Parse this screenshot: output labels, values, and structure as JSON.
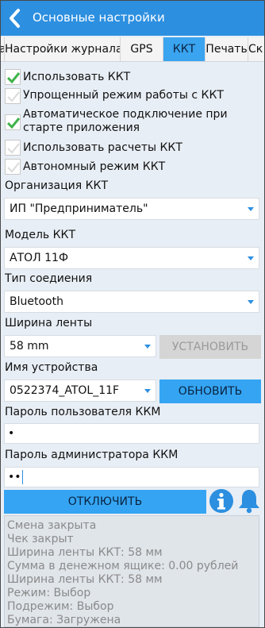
{
  "header": {
    "title": "Основные настройки"
  },
  "tabs": [
    {
      "label": "а"
    },
    {
      "label": "Настройки журнала"
    },
    {
      "label": "GPS"
    },
    {
      "label": "ККТ",
      "active": true
    },
    {
      "label": "Печать"
    },
    {
      "label": "Ск"
    }
  ],
  "checkboxes": [
    {
      "label": "Использовать ККТ",
      "checked": true
    },
    {
      "label": "Упрощенный режим работы с ККТ",
      "checked": false
    },
    {
      "label": "Автоматическое подключение при старте приложения",
      "checked": true
    },
    {
      "label": "Использовать расчеты ККТ",
      "checked": false
    },
    {
      "label": "Автономный режим ККТ",
      "checked": false
    }
  ],
  "org": {
    "label": "Организация ККТ",
    "value": "ИП \"Предприниматель\""
  },
  "model": {
    "label": "Модель ККТ",
    "value": "АТОЛ 11Ф"
  },
  "connection": {
    "label": "Тип соедиения",
    "value": "Bluetooth"
  },
  "tape": {
    "label": "Ширина ленты",
    "value": "58 mm",
    "button": "УСТАНОВИТЬ"
  },
  "device": {
    "label": "Имя устройства",
    "value": "0522374_ATOL_11F",
    "button": "ОБНОВИТЬ"
  },
  "user_password": {
    "label": "Пароль пользователя ККМ",
    "value": "•"
  },
  "admin_password": {
    "label": "Пароль администратора ККМ",
    "value": "••"
  },
  "disconnect_button": "ОТКЛЮЧИТЬ",
  "colors": {
    "accent": "#2c8fe0",
    "button": "#35a5f3",
    "background": "#e8eef5"
  },
  "log": [
    "Смена закрыта",
    "Чек закрыт",
    "Ширина ленты ККТ: 58 мм",
    "Сумма в денежном ящике: 0.00 рублей",
    "Ширина ленты ККТ: 58 мм",
    "Режим: Выбор",
    "Подрежим: Выбор",
    "Бумага: Загружена"
  ]
}
